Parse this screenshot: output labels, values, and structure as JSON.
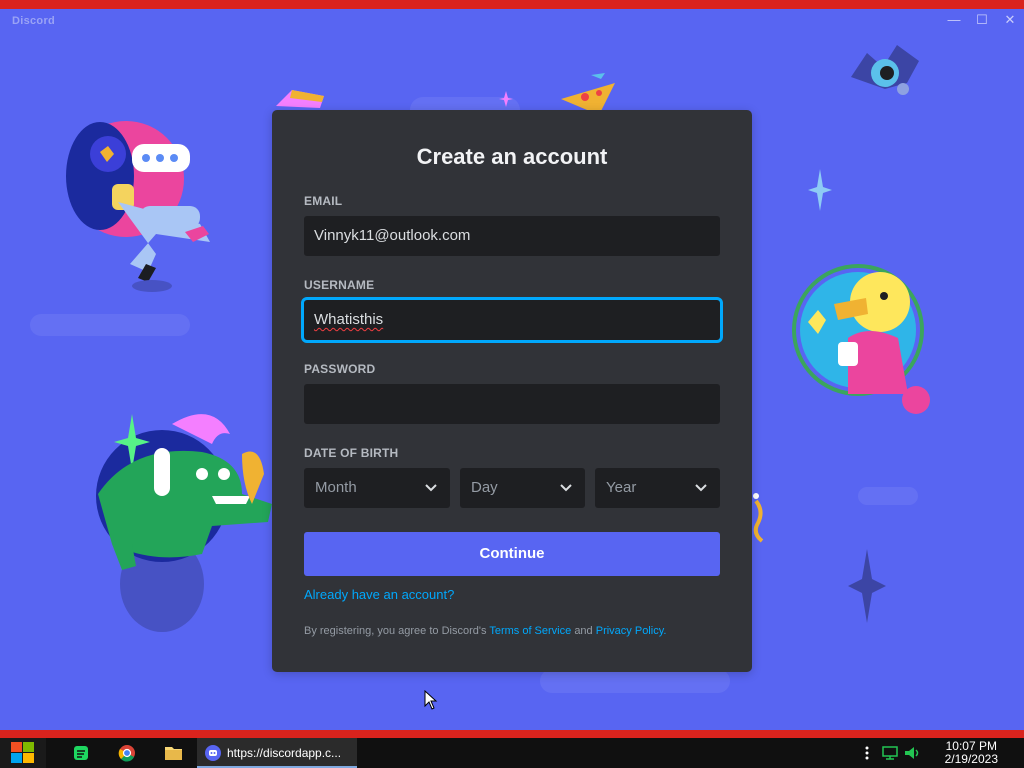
{
  "window": {
    "app_name": "Discord",
    "controls": {
      "minimize": "—",
      "maximize": "☐",
      "close": "✕"
    }
  },
  "form": {
    "title": "Create an account",
    "email": {
      "label": "EMAIL",
      "value": "Vinnyk11@outlook.com"
    },
    "username": {
      "label": "USERNAME",
      "value": "Whatisthis"
    },
    "password": {
      "label": "PASSWORD",
      "value": ""
    },
    "dob": {
      "label": "DATE OF BIRTH",
      "month_placeholder": "Month",
      "day_placeholder": "Day",
      "year_placeholder": "Year"
    },
    "continue_label": "Continue",
    "already_link": "Already have an account?",
    "legal": {
      "prefix": "By registering, you agree to Discord's",
      "tos": "Terms of Service",
      "and": "and",
      "privacy": "Privacy Policy",
      "suffix": "."
    }
  },
  "taskbar": {
    "task_label": "https://discordapp.c...",
    "time": "10:07 PM",
    "date": "2/19/2023"
  },
  "colors": {
    "background": "#5865f2",
    "modal": "#313338",
    "input": "#1e1f22",
    "accent": "#5865f2",
    "link": "#00a8fc",
    "focus": "#00a8fc"
  },
  "icons": [
    "windows-start-icon",
    "spotify-icon",
    "chrome-icon",
    "file-explorer-icon",
    "discord-icon",
    "overflow-dots-icon",
    "network-icon",
    "volume-icon",
    "chevron-down-icon"
  ]
}
